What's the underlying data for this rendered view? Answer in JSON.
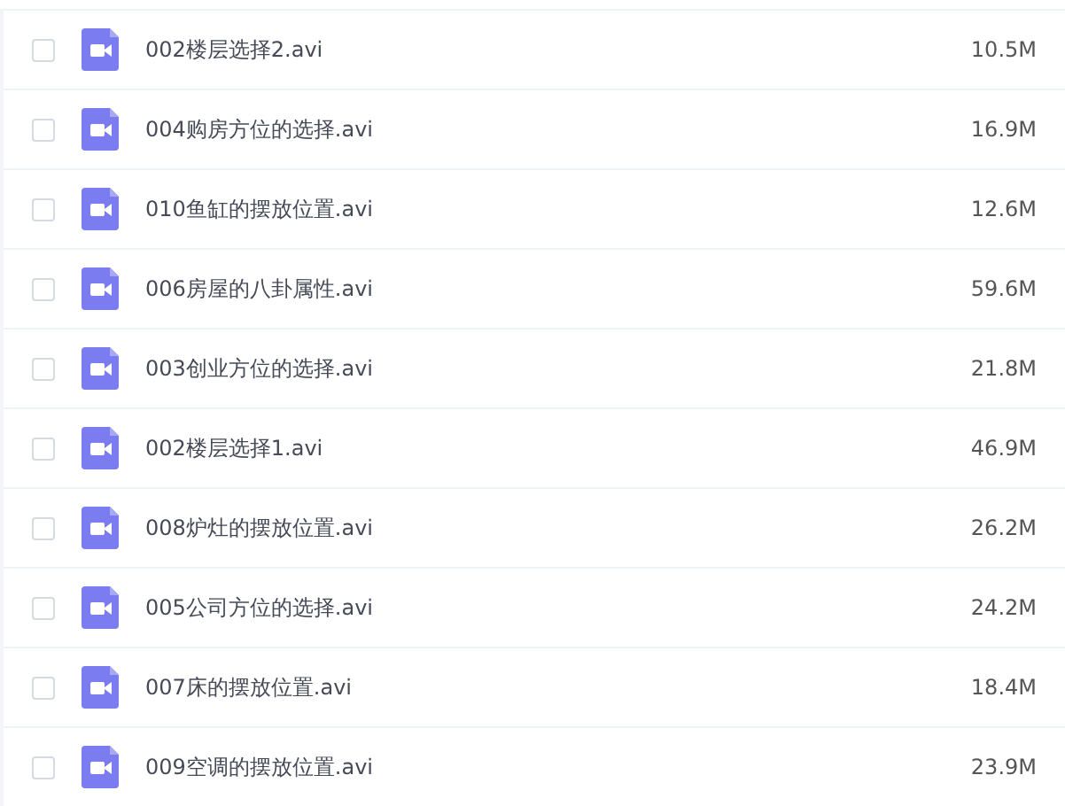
{
  "files": [
    {
      "name": "002楼层选择2.avi",
      "size": "10.5M",
      "checked": false
    },
    {
      "name": "004购房方位的选择.avi",
      "size": "16.9M",
      "checked": false
    },
    {
      "name": "010鱼缸的摆放位置.avi",
      "size": "12.6M",
      "checked": false
    },
    {
      "name": "006房屋的八卦属性.avi",
      "size": "59.6M",
      "checked": false
    },
    {
      "name": "003创业方位的选择.avi",
      "size": "21.8M",
      "checked": false
    },
    {
      "name": "002楼层选择1.avi",
      "size": "46.9M",
      "checked": false
    },
    {
      "name": "008炉灶的摆放位置.avi",
      "size": "26.2M",
      "checked": false
    },
    {
      "name": "005公司方位的选择.avi",
      "size": "24.2M",
      "checked": false
    },
    {
      "name": "007床的摆放位置.avi",
      "size": "18.4M",
      "checked": false
    },
    {
      "name": "009空调的摆放位置.avi",
      "size": "23.9M",
      "checked": false
    }
  ]
}
